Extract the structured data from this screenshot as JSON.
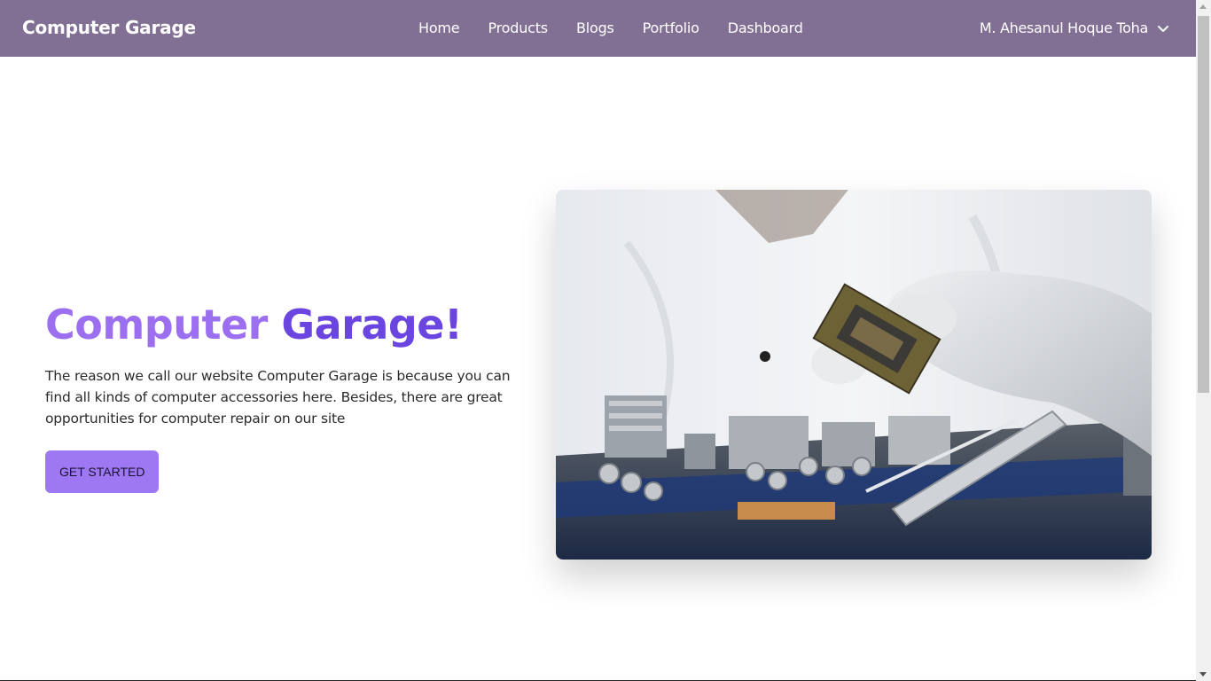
{
  "navbar": {
    "brand": "Computer Garage",
    "links": [
      {
        "label": "Home"
      },
      {
        "label": "Products"
      },
      {
        "label": "Blogs"
      },
      {
        "label": "Portfolio"
      },
      {
        "label": "Dashboard"
      }
    ],
    "user": {
      "name": "M. Ahesanul Hoque Toha",
      "icon": "chevron-down-icon"
    },
    "background": "#827094"
  },
  "hero": {
    "title_part1": "Computer",
    "title_part2": "Garage!",
    "description": "The reason we call our website Computer Garage is because you can find all kinds of computer accessories here. Besides, there are great opportunities for computer repair on our site",
    "cta_label": "GET STARTED",
    "colors": {
      "title_light": "#9b6ff0",
      "title_dark": "#6a45e0",
      "button": "#9d78f2"
    }
  }
}
